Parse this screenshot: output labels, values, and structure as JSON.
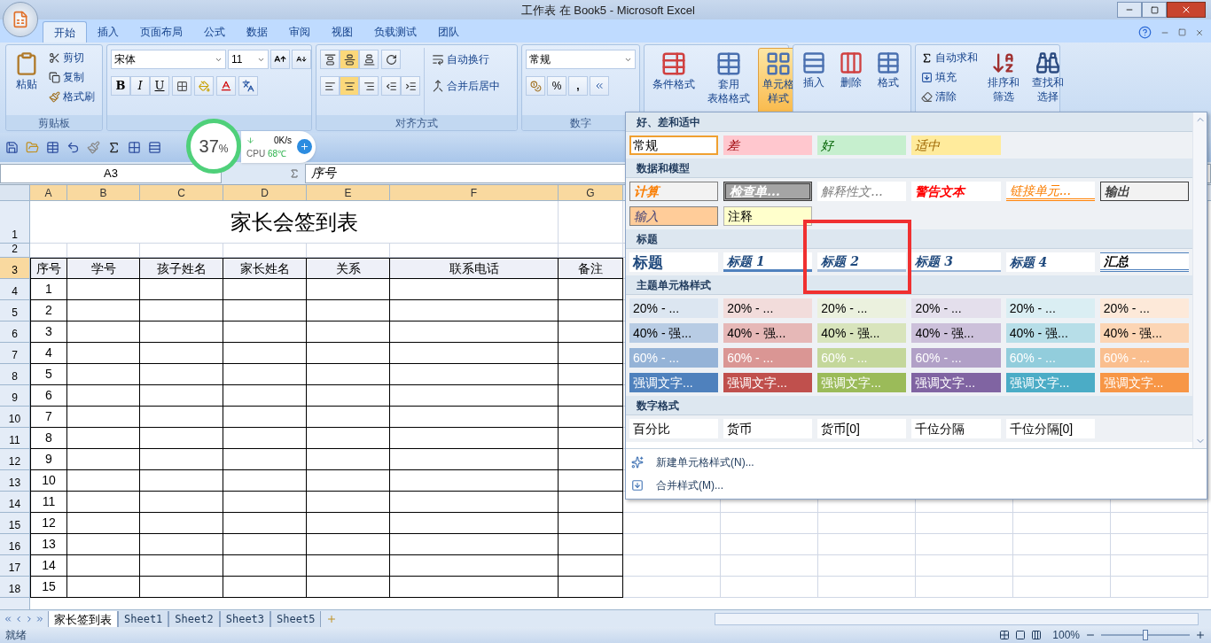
{
  "window": {
    "title": "工作表 在 Book5 - Microsoft Excel"
  },
  "ribbon_tabs": [
    {
      "label": "开始",
      "selected": true
    },
    {
      "label": "插入",
      "selected": false
    },
    {
      "label": "页面布局",
      "selected": false
    },
    {
      "label": "公式",
      "selected": false
    },
    {
      "label": "数据",
      "selected": false
    },
    {
      "label": "审阅",
      "selected": false
    },
    {
      "label": "视图",
      "selected": false
    },
    {
      "label": "负载测试",
      "selected": false
    },
    {
      "label": "团队",
      "selected": false
    }
  ],
  "clipboard": {
    "paste": "粘贴",
    "cut": "剪切",
    "copy": "复制",
    "format_painter": "格式刷",
    "group_label": "剪贴板"
  },
  "font": {
    "font_name": "宋体",
    "font_size": "11",
    "bold": "B",
    "italic": "I",
    "underline": "U"
  },
  "alignment": {
    "wrap_text": "自动换行",
    "merge_center": "合并后居中",
    "group_label": "对齐方式"
  },
  "number": {
    "format": "常规",
    "percent": "%",
    "comma": ",",
    "group_label": "数字"
  },
  "styles": [
    {
      "lines": [
        "条件格式"
      ],
      "selected": false
    },
    {
      "lines": [
        "套用",
        "表格格式"
      ],
      "selected": false
    },
    {
      "lines": [
        "单元格",
        "样式"
      ],
      "selected": true
    }
  ],
  "cells_group": [
    {
      "label": "插入"
    },
    {
      "label": "删除"
    },
    {
      "label": "格式"
    }
  ],
  "editing": {
    "autosum": "自动求和",
    "fill": "填充",
    "clear": "清除",
    "sort": [
      "排序和",
      "筛选"
    ],
    "find": [
      "查找和",
      "选择"
    ]
  },
  "monitor_widget": {
    "percent": "37",
    "unit": "%",
    "speed": "0K/s",
    "cpu_label": "CPU",
    "cpu_temp": "68℃"
  },
  "formula_bar": {
    "name_box": "A3",
    "value": "序号"
  },
  "sheet": {
    "columns": [
      {
        "label": "A",
        "selected": true
      },
      {
        "label": "B",
        "selected": true
      },
      {
        "label": "C",
        "selected": true
      },
      {
        "label": "D",
        "selected": true
      },
      {
        "label": "E",
        "selected": true
      },
      {
        "label": "F",
        "selected": true
      },
      {
        "label": "G",
        "selected": true
      }
    ],
    "rows": [
      {
        "header": "1",
        "kind": "title",
        "selected": false,
        "title": "家长会签到表",
        "cells": []
      },
      {
        "header": "2",
        "kind": "blank",
        "selected": false,
        "cells": []
      },
      {
        "header": "3",
        "kind": "header",
        "selected": true,
        "cells": [
          "序号",
          "学号",
          "孩子姓名",
          "家长姓名",
          "关系",
          "联系电话",
          "备注"
        ]
      },
      {
        "header": "4",
        "kind": "data",
        "selected": false,
        "cells": [
          "1"
        ]
      },
      {
        "header": "5",
        "kind": "data",
        "selected": false,
        "cells": [
          "2"
        ]
      },
      {
        "header": "6",
        "kind": "data",
        "selected": false,
        "cells": [
          "3"
        ]
      },
      {
        "header": "7",
        "kind": "data",
        "selected": false,
        "cells": [
          "4"
        ]
      },
      {
        "header": "8",
        "kind": "data",
        "selected": false,
        "cells": [
          "5"
        ]
      },
      {
        "header": "9",
        "kind": "data",
        "selected": false,
        "cells": [
          "6"
        ]
      },
      {
        "header": "10",
        "kind": "data",
        "selected": false,
        "cells": [
          "7"
        ]
      },
      {
        "header": "11",
        "kind": "data",
        "selected": false,
        "cells": [
          "8"
        ]
      },
      {
        "header": "12",
        "kind": "data",
        "selected": false,
        "cells": [
          "9"
        ]
      },
      {
        "header": "13",
        "kind": "data",
        "selected": false,
        "cells": [
          "10"
        ]
      },
      {
        "header": "14",
        "kind": "data",
        "selected": false,
        "cells": [
          "11"
        ]
      },
      {
        "header": "15",
        "kind": "data",
        "selected": false,
        "cells": [
          "12"
        ]
      },
      {
        "header": "16",
        "kind": "data",
        "selected": false,
        "cells": [
          "13"
        ]
      },
      {
        "header": "17",
        "kind": "data",
        "selected": false,
        "cells": [
          "14"
        ]
      },
      {
        "header": "18",
        "kind": "data",
        "selected": false,
        "cells": [
          "15"
        ]
      }
    ]
  },
  "cell_styles_gallery": {
    "sections": [
      {
        "title": "好、差和适中",
        "items": [
          {
            "label": "常规",
            "kind": "normal",
            "color": "#ffffff",
            "selected": true
          },
          {
            "label": "差",
            "kind": "bad",
            "color": "#ffc7ce",
            "selected": false
          },
          {
            "label": "好",
            "kind": "good",
            "color": "#c6efce",
            "selected": false
          },
          {
            "label": "适中",
            "kind": "neutral",
            "color": "#ffeb9c",
            "selected": false
          }
        ]
      },
      {
        "title": "数据和模型",
        "items": [
          {
            "label": "计算",
            "kind": "calc",
            "color": "#f2f2f2",
            "selected": false
          },
          {
            "label": "检查单...",
            "kind": "check",
            "color": "#a5a5a5",
            "selected": false
          },
          {
            "label": "解释性文...",
            "kind": "explain",
            "color": "#ffffff",
            "selected": false
          },
          {
            "label": "警告文本",
            "kind": "warning",
            "color": "#ffffff",
            "selected": false
          },
          {
            "label": "链接单元...",
            "kind": "linked",
            "color": "#ffffff",
            "selected": false
          },
          {
            "label": "输出",
            "kind": "output",
            "color": "#f2f2f2",
            "selected": false
          },
          {
            "label": "输入",
            "kind": "input",
            "color": "#ffcc99",
            "selected": false
          },
          {
            "label": "注释",
            "kind": "note",
            "color": "#ffffcc",
            "selected": false
          }
        ]
      },
      {
        "title": "标题",
        "items": [
          {
            "label": "标题",
            "kind": "title",
            "color": "#ffffff",
            "selected": false
          },
          {
            "label": "标题 1",
            "kind": "h1",
            "color": "#ffffff",
            "selected": false
          },
          {
            "label": "标题 2",
            "kind": "h2",
            "color": "#ffffff",
            "selected": false
          },
          {
            "label": "标题 3",
            "kind": "h3",
            "color": "#ffffff",
            "selected": false
          },
          {
            "label": "标题 4",
            "kind": "h4",
            "color": "#ffffff",
            "selected": false
          },
          {
            "label": "汇总",
            "kind": "total",
            "color": "#ffffff",
            "selected": false
          }
        ]
      },
      {
        "title": "主题单元格样式",
        "items": [
          {
            "label": "20% - ...",
            "kind": "light",
            "color": "#dce6f1",
            "selected": false
          },
          {
            "label": "20% - ...",
            "kind": "light",
            "color": "#f2dcdb",
            "selected": false
          },
          {
            "label": "20% - ...",
            "kind": "light",
            "color": "#ebf1de",
            "selected": false
          },
          {
            "label": "20% - ...",
            "kind": "light",
            "color": "#e4dfec",
            "selected": false
          },
          {
            "label": "20% - ...",
            "kind": "light",
            "color": "#daeef3",
            "selected": false
          },
          {
            "label": "20% - ...",
            "kind": "light",
            "color": "#fde9d9",
            "selected": false
          },
          {
            "label": "40% - 强...",
            "kind": "light",
            "color": "#b8cce4",
            "selected": false
          },
          {
            "label": "40% - 强...",
            "kind": "light",
            "color": "#e6b8b7",
            "selected": false
          },
          {
            "label": "40% - 强...",
            "kind": "light",
            "color": "#d8e4bc",
            "selected": false
          },
          {
            "label": "40% - 强...",
            "kind": "light",
            "color": "#ccc0da",
            "selected": false
          },
          {
            "label": "40% - 强...",
            "kind": "light",
            "color": "#b7dee8",
            "selected": false
          },
          {
            "label": "40% - 强...",
            "kind": "light",
            "color": "#fcd5b4",
            "selected": false
          },
          {
            "label": "60% - ...",
            "kind": "dark",
            "color": "#95b3d7",
            "selected": false
          },
          {
            "label": "60% - ...",
            "kind": "dark",
            "color": "#da9694",
            "selected": false
          },
          {
            "label": "60% - ...",
            "kind": "dark",
            "color": "#c4d79b",
            "selected": false
          },
          {
            "label": "60% - ...",
            "kind": "dark",
            "color": "#b1a0c7",
            "selected": false
          },
          {
            "label": "60% - ...",
            "kind": "dark",
            "color": "#92cddc",
            "selected": false
          },
          {
            "label": "60% - ...",
            "kind": "dark",
            "color": "#fabf8f",
            "selected": false
          },
          {
            "label": "强调文字...",
            "kind": "dark",
            "color": "#4f81bd",
            "selected": false
          },
          {
            "label": "强调文字...",
            "kind": "dark",
            "color": "#c0504d",
            "selected": false
          },
          {
            "label": "强调文字...",
            "kind": "dark",
            "color": "#9bbb59",
            "selected": false
          },
          {
            "label": "强调文字...",
            "kind": "dark",
            "color": "#8064a2",
            "selected": false
          },
          {
            "label": "强调文字...",
            "kind": "dark",
            "color": "#4bacc6",
            "selected": false
          },
          {
            "label": "强调文字...",
            "kind": "dark",
            "color": "#f79646",
            "selected": false
          }
        ]
      },
      {
        "title": "数字格式",
        "items": [
          {
            "label": "百分比",
            "kind": "number",
            "color": "#ffffff",
            "selected": false
          },
          {
            "label": "货币",
            "kind": "number",
            "color": "#ffffff",
            "selected": false
          },
          {
            "label": "货币[0]",
            "kind": "number",
            "color": "#ffffff",
            "selected": false
          },
          {
            "label": "千位分隔",
            "kind": "number",
            "color": "#ffffff",
            "selected": false
          },
          {
            "label": "千位分隔[0]",
            "kind": "number",
            "color": "#ffffff",
            "selected": false
          }
        ]
      }
    ],
    "commands": [
      "新建单元格样式(N)...",
      "合并样式(M)..."
    ]
  },
  "sheet_tabs": [
    {
      "label": "家长签到表",
      "selected": true
    },
    {
      "label": "Sheet1",
      "selected": false
    },
    {
      "label": "Sheet2",
      "selected": false
    },
    {
      "label": "Sheet3",
      "selected": false
    },
    {
      "label": "Sheet5",
      "selected": false
    }
  ],
  "status_bar": {
    "status": "就绪",
    "zoom": "100%",
    "zoom_slider": {
      "level": 0.5
    }
  }
}
